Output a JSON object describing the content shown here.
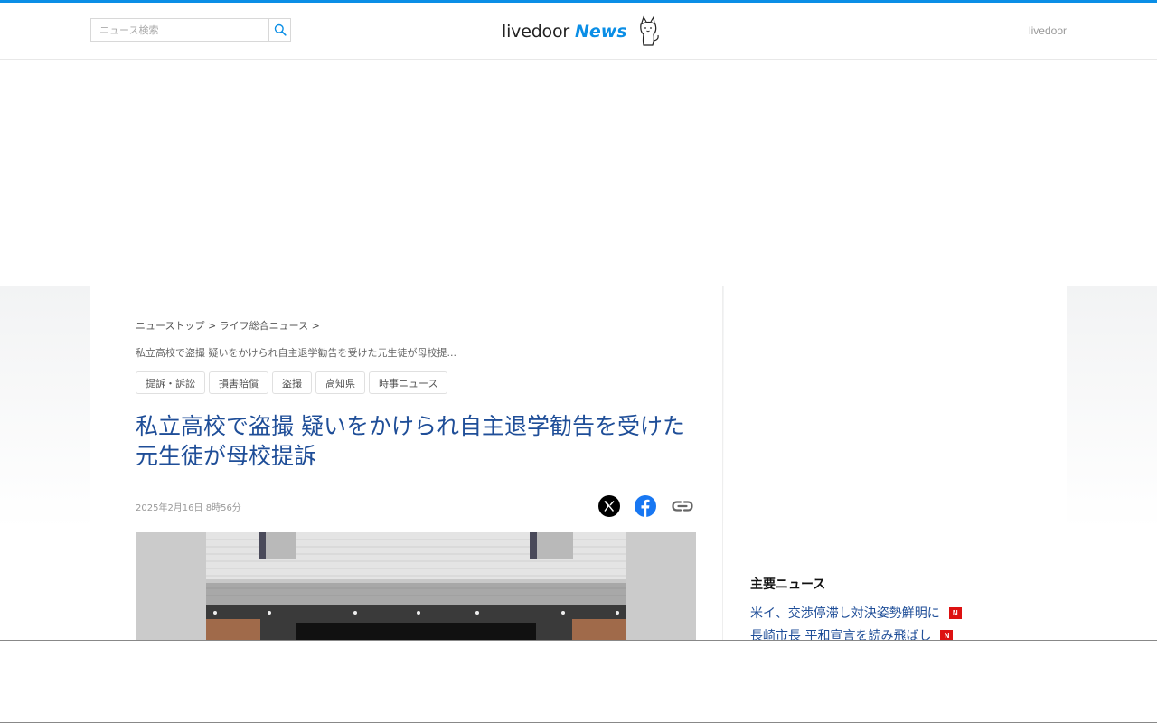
{
  "header": {
    "search_placeholder": "ニュース検索",
    "logo_text": "livedoor",
    "logo_news": "News",
    "site_link": "livedoor"
  },
  "breadcrumb": {
    "items": [
      "ニューストップ",
      "ライフ総合ニュース"
    ],
    "separator": ">",
    "current": "私立高校で盗撮 疑いをかけられ自主退学勧告を受けた元生徒が母校提..."
  },
  "tags": [
    "提訴・訴訟",
    "損害賠償",
    "盗撮",
    "高知県",
    "時事ニュース"
  ],
  "article": {
    "title": "私立高校で盗撮 疑いをかけられ自主退学勧告を受けた元生徒が母校提訴",
    "date": "2025年2月16日 8時56分"
  },
  "share": {
    "icons": [
      "x-icon",
      "facebook-icon",
      "link-icon"
    ]
  },
  "sidebar": {
    "heading": "主要ニュース",
    "items": [
      {
        "text": "米イ、交渉停滞し対決姿勢鮮明に",
        "badge": "N"
      },
      {
        "text": "長崎市長 平和宣言を読み飛ばし",
        "badge": "N"
      }
    ]
  },
  "colors": {
    "accent": "#0a8ee6",
    "title": "#1f4e98",
    "badge": "#dd1111"
  }
}
